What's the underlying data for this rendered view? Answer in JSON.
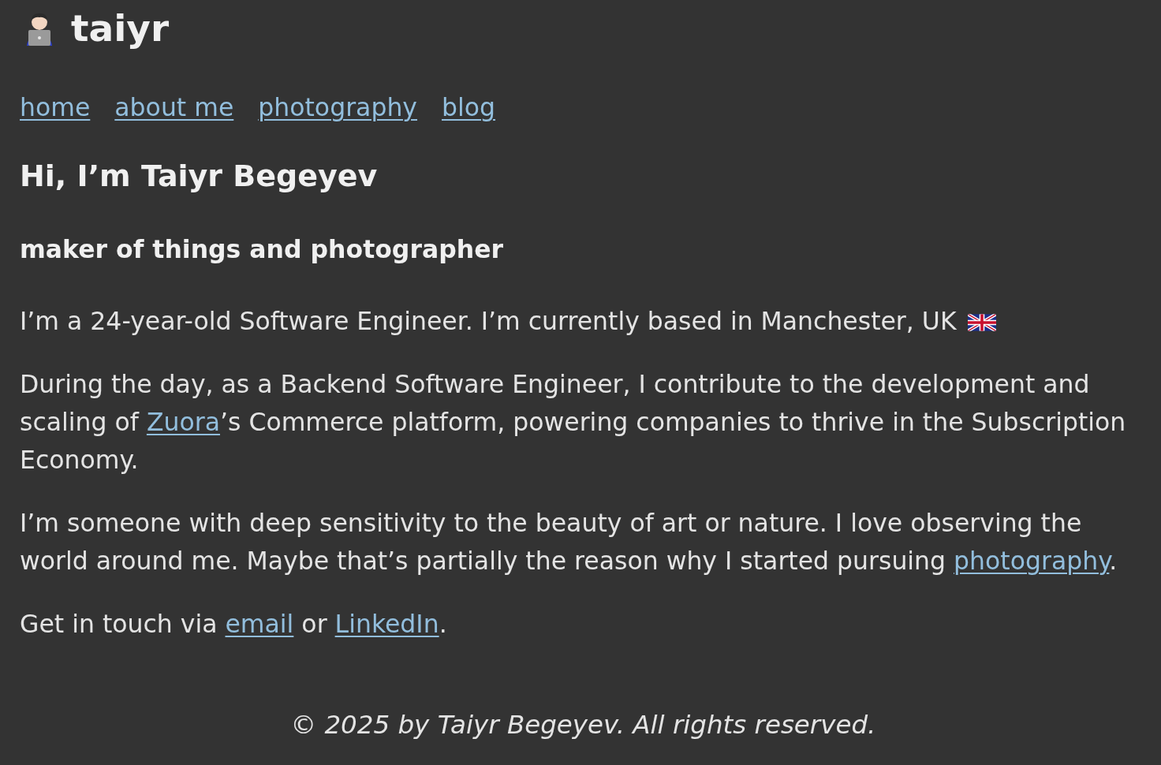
{
  "site": {
    "title": "taiyr"
  },
  "nav": [
    {
      "label": "home"
    },
    {
      "label": "about me"
    },
    {
      "label": "photography"
    },
    {
      "label": "blog"
    }
  ],
  "heading": "Hi, I’m Taiyr Begeyev",
  "subheading": "maker of things and photographer",
  "paragraphs": [
    {
      "parts": [
        {
          "kind": "text",
          "text": "I’m a 24-year-old Software Engineer. I’m currently based in Manchester, UK"
        },
        {
          "kind": "icon"
        }
      ]
    },
    {
      "parts": [
        {
          "kind": "text",
          "text": "During the day, as a Backend Software Engineer, I contribute to the development and scaling of "
        },
        {
          "kind": "link",
          "text": "Zuora"
        },
        {
          "kind": "text",
          "text": "’s Commerce platform, powering companies to thrive in the Subscription Economy."
        }
      ]
    },
    {
      "parts": [
        {
          "kind": "text",
          "text": "I’m someone with deep sensitivity to the beauty of art or nature. I love observing the world around me. Maybe that’s partially the reason why I started pursuing "
        },
        {
          "kind": "link",
          "text": "photography"
        },
        {
          "kind": "text",
          "text": "."
        }
      ]
    },
    {
      "parts": [
        {
          "kind": "text",
          "text": "Get in touch via "
        },
        {
          "kind": "link",
          "text": "email"
        },
        {
          "kind": "text",
          "text": " or "
        },
        {
          "kind": "link",
          "text": "LinkedIn"
        },
        {
          "kind": "text",
          "text": "."
        }
      ]
    }
  ],
  "footer": "© 2025 by Taiyr Begeyev. All rights reserved."
}
